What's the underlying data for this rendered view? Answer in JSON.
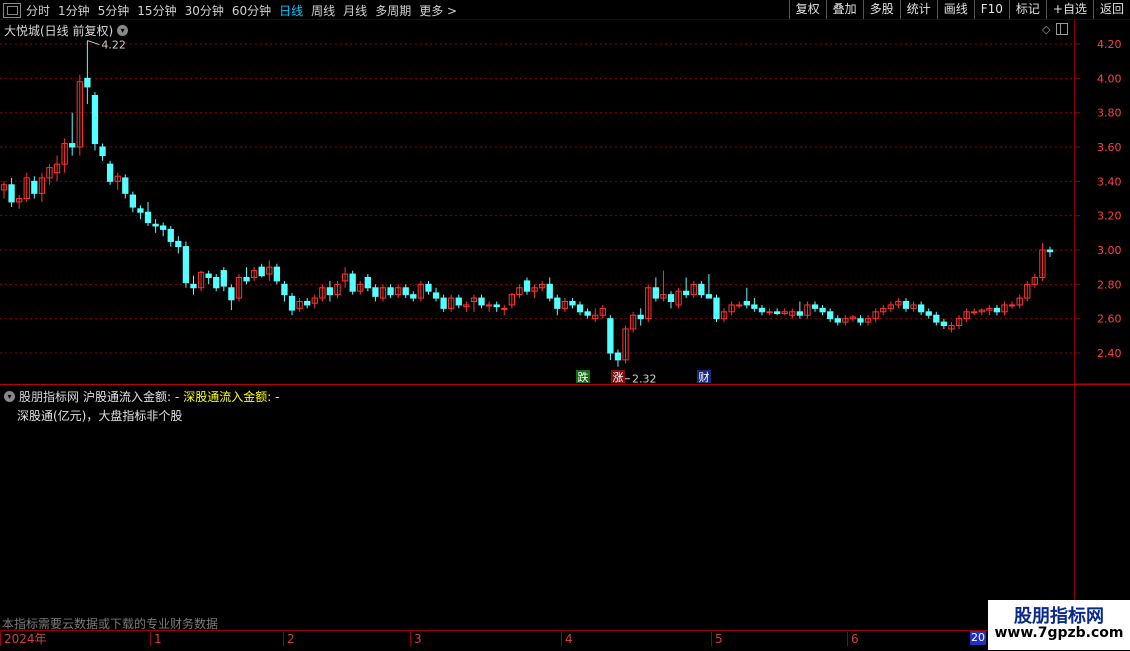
{
  "toolbar": {
    "periods": [
      "分时",
      "1分钟",
      "5分钟",
      "15分钟",
      "30分钟",
      "60分钟",
      "日线",
      "周线",
      "月线",
      "多周期",
      "更多 >"
    ],
    "active_period": "日线",
    "right_buttons": [
      "复权",
      "叠加",
      "多股",
      "统计",
      "画线",
      "F10",
      "标记",
      "+自选",
      "返回"
    ]
  },
  "main_panel": {
    "title": "大悦城(日线 前复权)",
    "high_label": "4.22",
    "low_label": "2.32",
    "event_marks": [
      "跌",
      "涨",
      "财"
    ]
  },
  "sub_panel": {
    "title": "股朋指标网",
    "label_a": "沪股通流入金额: -",
    "label_b": "深股通流入金额: -",
    "note": "深股通(亿元)，大盘指标非个股"
  },
  "bottom_note": "本指标需要云数据或下载的专业财务数据",
  "date_axis": [
    "2024年",
    "1",
    "2",
    "3",
    "4",
    "5",
    "6"
  ],
  "date_box": "20",
  "brand": {
    "name": "股朋指标网",
    "url": "www.7gpzb.com"
  },
  "colors": {
    "up": "#ff3232",
    "down": "#54ffff",
    "grid": "#8b0000",
    "axis_text": "#ff4040"
  },
  "chart_data": {
    "type": "candlestick",
    "title": "大悦城(日线 前复权)",
    "yticks": [
      4.2,
      4.0,
      3.8,
      3.6,
      3.4,
      3.2,
      3.0,
      2.8,
      2.6,
      2.4
    ],
    "ylim": [
      2.28,
      4.3
    ],
    "grid": true,
    "annotations": [
      {
        "text": "4.22",
        "type": "max"
      },
      {
        "text": "2.32",
        "type": "min"
      }
    ],
    "ohlc": [
      [
        3.35,
        3.4,
        3.3,
        3.38
      ],
      [
        3.38,
        3.42,
        3.25,
        3.28
      ],
      [
        3.28,
        3.32,
        3.24,
        3.3
      ],
      [
        3.3,
        3.45,
        3.28,
        3.42
      ],
      [
        3.4,
        3.43,
        3.3,
        3.33
      ],
      [
        3.33,
        3.45,
        3.28,
        3.42
      ],
      [
        3.42,
        3.5,
        3.38,
        3.48
      ],
      [
        3.45,
        3.55,
        3.4,
        3.5
      ],
      [
        3.5,
        3.65,
        3.45,
        3.62
      ],
      [
        3.62,
        3.8,
        3.55,
        3.6
      ],
      [
        3.6,
        4.02,
        3.55,
        3.98
      ],
      [
        4.0,
        4.22,
        3.85,
        3.95
      ],
      [
        3.9,
        3.92,
        3.58,
        3.62
      ],
      [
        3.6,
        3.62,
        3.52,
        3.55
      ],
      [
        3.5,
        3.52,
        3.38,
        3.4
      ],
      [
        3.4,
        3.45,
        3.35,
        3.43
      ],
      [
        3.42,
        3.44,
        3.3,
        3.33
      ],
      [
        3.32,
        3.34,
        3.22,
        3.25
      ],
      [
        3.24,
        3.26,
        3.18,
        3.22
      ],
      [
        3.22,
        3.28,
        3.14,
        3.16
      ],
      [
        3.15,
        3.18,
        3.1,
        3.14
      ],
      [
        3.14,
        3.16,
        3.08,
        3.12
      ],
      [
        3.12,
        3.14,
        3.02,
        3.05
      ],
      [
        3.05,
        3.08,
        2.98,
        3.02
      ],
      [
        3.02,
        3.05,
        2.78,
        2.81
      ],
      [
        2.8,
        2.85,
        2.74,
        2.78
      ],
      [
        2.78,
        2.88,
        2.76,
        2.87
      ],
      [
        2.86,
        2.88,
        2.8,
        2.84
      ],
      [
        2.84,
        2.86,
        2.76,
        2.78
      ],
      [
        2.88,
        2.9,
        2.76,
        2.79
      ],
      [
        2.78,
        2.8,
        2.65,
        2.71
      ],
      [
        2.72,
        2.86,
        2.7,
        2.84
      ],
      [
        2.84,
        2.9,
        2.8,
        2.82
      ],
      [
        2.84,
        2.9,
        2.82,
        2.88
      ],
      [
        2.9,
        2.92,
        2.84,
        2.85
      ],
      [
        2.86,
        2.94,
        2.82,
        2.9
      ],
      [
        2.9,
        2.92,
        2.8,
        2.82
      ],
      [
        2.8,
        2.82,
        2.7,
        2.74
      ],
      [
        2.73,
        2.75,
        2.62,
        2.65
      ],
      [
        2.66,
        2.72,
        2.64,
        2.7
      ],
      [
        2.7,
        2.72,
        2.66,
        2.68
      ],
      [
        2.69,
        2.74,
        2.66,
        2.72
      ],
      [
        2.72,
        2.8,
        2.7,
        2.78
      ],
      [
        2.78,
        2.82,
        2.7,
        2.74
      ],
      [
        2.74,
        2.82,
        2.72,
        2.8
      ],
      [
        2.82,
        2.9,
        2.78,
        2.86
      ],
      [
        2.86,
        2.88,
        2.74,
        2.76
      ],
      [
        2.76,
        2.82,
        2.74,
        2.8
      ],
      [
        2.84,
        2.86,
        2.76,
        2.78
      ],
      [
        2.78,
        2.8,
        2.7,
        2.73
      ],
      [
        2.72,
        2.8,
        2.7,
        2.78
      ],
      [
        2.78,
        2.8,
        2.72,
        2.74
      ],
      [
        2.74,
        2.8,
        2.72,
        2.78
      ],
      [
        2.78,
        2.8,
        2.72,
        2.74
      ],
      [
        2.74,
        2.76,
        2.7,
        2.72
      ],
      [
        2.72,
        2.82,
        2.7,
        2.8
      ],
      [
        2.8,
        2.82,
        2.74,
        2.76
      ],
      [
        2.75,
        2.78,
        2.7,
        2.72
      ],
      [
        2.72,
        2.74,
        2.64,
        2.66
      ],
      [
        2.66,
        2.74,
        2.64,
        2.72
      ],
      [
        2.72,
        2.74,
        2.66,
        2.68
      ],
      [
        2.67,
        2.7,
        2.64,
        2.68
      ],
      [
        2.7,
        2.74,
        2.64,
        2.72
      ],
      [
        2.72,
        2.74,
        2.66,
        2.68
      ],
      [
        2.68,
        2.7,
        2.64,
        2.68
      ],
      [
        2.68,
        2.7,
        2.64,
        2.67
      ],
      [
        2.66,
        2.68,
        2.62,
        2.66
      ],
      [
        2.68,
        2.75,
        2.66,
        2.74
      ],
      [
        2.74,
        2.8,
        2.72,
        2.78
      ],
      [
        2.82,
        2.84,
        2.74,
        2.76
      ],
      [
        2.76,
        2.8,
        2.72,
        2.78
      ],
      [
        2.78,
        2.82,
        2.76,
        2.8
      ],
      [
        2.8,
        2.84,
        2.7,
        2.72
      ],
      [
        2.72,
        2.74,
        2.62,
        2.66
      ],
      [
        2.66,
        2.72,
        2.64,
        2.7
      ],
      [
        2.7,
        2.72,
        2.66,
        2.68
      ],
      [
        2.68,
        2.7,
        2.62,
        2.64
      ],
      [
        2.64,
        2.66,
        2.6,
        2.62
      ],
      [
        2.6,
        2.66,
        2.58,
        2.62
      ],
      [
        2.62,
        2.68,
        2.6,
        2.66
      ],
      [
        2.6,
        2.62,
        2.36,
        2.4
      ],
      [
        2.4,
        2.42,
        2.32,
        2.36
      ],
      [
        2.36,
        2.56,
        2.34,
        2.54
      ],
      [
        2.54,
        2.64,
        2.52,
        2.62
      ],
      [
        2.62,
        2.66,
        2.56,
        2.6
      ],
      [
        2.6,
        2.8,
        2.58,
        2.78
      ],
      [
        2.78,
        2.84,
        2.7,
        2.72
      ],
      [
        2.72,
        2.88,
        2.7,
        2.74
      ],
      [
        2.74,
        2.76,
        2.66,
        2.7
      ],
      [
        2.68,
        2.78,
        2.66,
        2.76
      ],
      [
        2.76,
        2.84,
        2.72,
        2.74
      ],
      [
        2.74,
        2.82,
        2.72,
        2.8
      ],
      [
        2.8,
        2.82,
        2.72,
        2.74
      ],
      [
        2.74,
        2.86,
        2.72,
        2.72
      ],
      [
        2.72,
        2.74,
        2.58,
        2.6
      ],
      [
        2.6,
        2.66,
        2.58,
        2.64
      ],
      [
        2.64,
        2.7,
        2.62,
        2.68
      ],
      [
        2.68,
        2.7,
        2.66,
        2.68
      ],
      [
        2.7,
        2.78,
        2.66,
        2.68
      ],
      [
        2.68,
        2.72,
        2.64,
        2.66
      ],
      [
        2.66,
        2.68,
        2.62,
        2.64
      ],
      [
        2.64,
        2.66,
        2.62,
        2.64
      ],
      [
        2.64,
        2.66,
        2.62,
        2.63
      ],
      [
        2.63,
        2.66,
        2.62,
        2.64
      ],
      [
        2.62,
        2.66,
        2.6,
        2.64
      ],
      [
        2.64,
        2.7,
        2.6,
        2.62
      ],
      [
        2.62,
        2.7,
        2.6,
        2.68
      ],
      [
        2.68,
        2.7,
        2.64,
        2.66
      ],
      [
        2.66,
        2.68,
        2.62,
        2.64
      ],
      [
        2.64,
        2.66,
        2.58,
        2.6
      ],
      [
        2.6,
        2.62,
        2.56,
        2.58
      ],
      [
        2.58,
        2.62,
        2.56,
        2.6
      ],
      [
        2.6,
        2.62,
        2.58,
        2.61
      ],
      [
        2.6,
        2.62,
        2.56,
        2.58
      ],
      [
        2.58,
        2.62,
        2.56,
        2.6
      ],
      [
        2.6,
        2.66,
        2.58,
        2.64
      ],
      [
        2.64,
        2.68,
        2.62,
        2.66
      ],
      [
        2.66,
        2.7,
        2.64,
        2.68
      ],
      [
        2.68,
        2.72,
        2.66,
        2.7
      ],
      [
        2.7,
        2.72,
        2.64,
        2.66
      ],
      [
        2.66,
        2.7,
        2.64,
        2.68
      ],
      [
        2.68,
        2.7,
        2.62,
        2.64
      ],
      [
        2.64,
        2.66,
        2.6,
        2.62
      ],
      [
        2.62,
        2.64,
        2.56,
        2.58
      ],
      [
        2.58,
        2.6,
        2.54,
        2.56
      ],
      [
        2.54,
        2.58,
        2.52,
        2.56
      ],
      [
        2.56,
        2.62,
        2.54,
        2.6
      ],
      [
        2.6,
        2.66,
        2.58,
        2.64
      ],
      [
        2.64,
        2.66,
        2.62,
        2.64
      ],
      [
        2.64,
        2.66,
        2.62,
        2.65
      ],
      [
        2.65,
        2.68,
        2.62,
        2.66
      ],
      [
        2.66,
        2.68,
        2.62,
        2.64
      ],
      [
        2.64,
        2.7,
        2.62,
        2.68
      ],
      [
        2.68,
        2.7,
        2.66,
        2.68
      ],
      [
        2.68,
        2.74,
        2.66,
        2.72
      ],
      [
        2.72,
        2.82,
        2.7,
        2.8
      ],
      [
        2.8,
        2.86,
        2.78,
        2.84
      ],
      [
        2.84,
        3.04,
        2.82,
        3.0
      ],
      [
        3.0,
        3.02,
        2.96,
        2.99
      ]
    ]
  }
}
